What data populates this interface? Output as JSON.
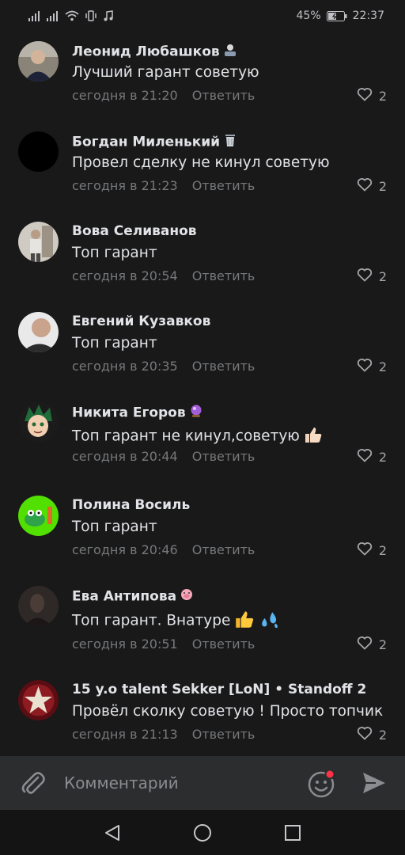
{
  "status": {
    "battery": "45%",
    "time": "22:37"
  },
  "comments": [
    {
      "name": "Леонид Любашков",
      "badge": "technologist-emoji",
      "text": "Лучший гарант советую",
      "time": "сегодня в 21:20",
      "reply": "Ответить",
      "likes": "2"
    },
    {
      "name": "Богдан Миленький",
      "badge": "wastebasket-emoji",
      "text": "Провел сделку не кинул советую",
      "time": "сегодня в 21:23",
      "reply": "Ответить",
      "likes": "2"
    },
    {
      "name": "Вова Селиванов",
      "text": "Топ гарант",
      "time": "сегодня в 20:54",
      "reply": "Ответить",
      "likes": "2"
    },
    {
      "name": "Евгений Кузавков",
      "text": "Топ гарант",
      "time": "сегодня в 20:35",
      "reply": "Ответить",
      "likes": "2"
    },
    {
      "name": "Никита Егоров",
      "badge": "crystal-ball-emoji",
      "text": "Топ гарант не кинул,советую",
      "text_emoji": "thumbs-up-emoji",
      "time": "сегодня в 20:44",
      "reply": "Ответить",
      "likes": "2"
    },
    {
      "name": "Полина Восиль",
      "text": "Топ гарант",
      "time": "сегодня в 20:46",
      "reply": "Ответить",
      "likes": "2"
    },
    {
      "name": "Ева Антипова",
      "badge": "pig-emoji",
      "text": "Топ гарант. Внатуре",
      "text_emoji": "thumbs-up-sweat-emoji",
      "time": "сегодня в 20:51",
      "reply": "Ответить",
      "likes": "2"
    },
    {
      "name": "15 y.o talent Sekker [LoN] • Standoff 2",
      "text": "Провёл сколку советую ! Просто топчик",
      "time": "сегодня в 21:13",
      "reply": "Ответить",
      "likes": "2"
    }
  ],
  "composer": {
    "placeholder": "Комментарий"
  },
  "colors": {
    "background": "#19191a",
    "composer": "#2c2d2e",
    "notification_dot": "#ff3347"
  }
}
